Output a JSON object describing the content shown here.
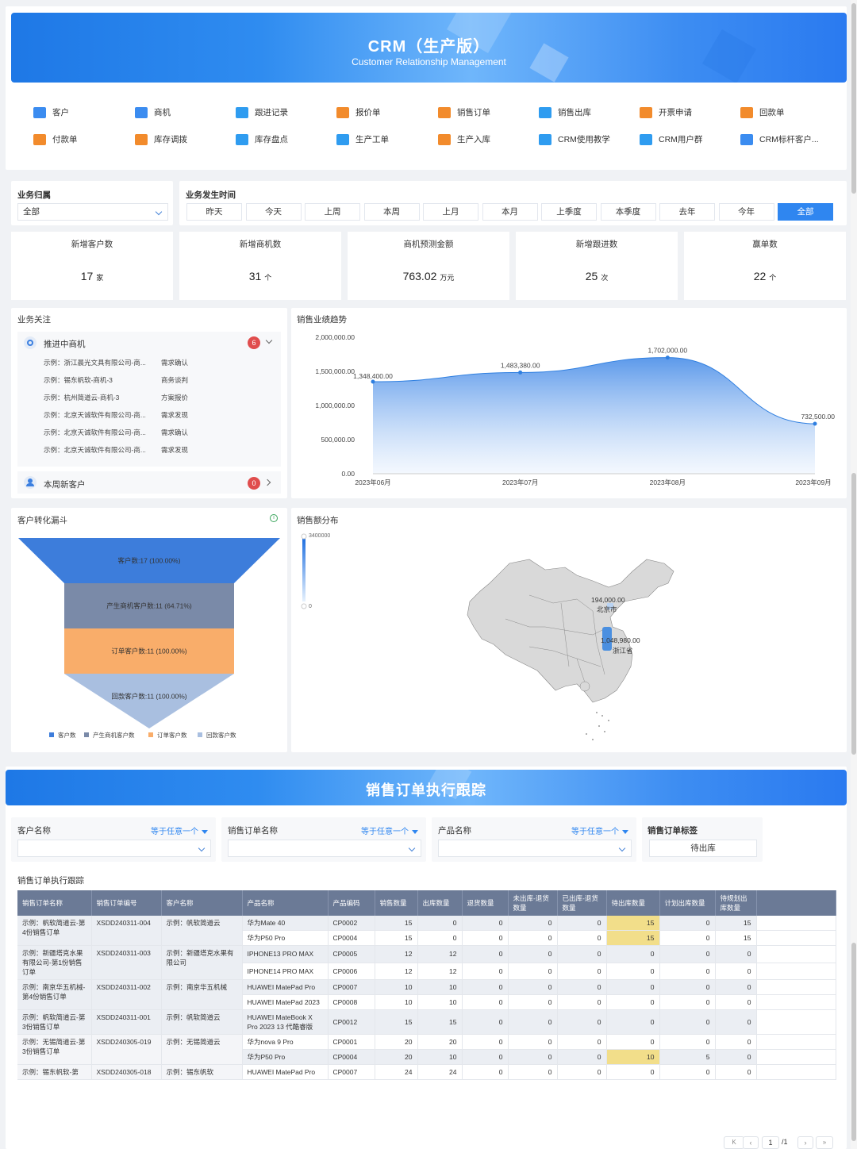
{
  "banner": {
    "title": "CRM（生产版）",
    "subtitle": "Customer Relationship Management"
  },
  "quick_links": [
    {
      "label": "客户",
      "icon": "user-icon",
      "color": "blue"
    },
    {
      "label": "商机",
      "icon": "target-icon",
      "color": "blue"
    },
    {
      "label": "跟进记录",
      "icon": "note-icon",
      "color": "teal"
    },
    {
      "label": "报价单",
      "icon": "send-icon",
      "color": "orange"
    },
    {
      "label": "销售订单",
      "icon": "order-icon",
      "color": "orange"
    },
    {
      "label": "销售出库",
      "icon": "doc-icon",
      "color": "teal"
    },
    {
      "label": "开票申请",
      "icon": "org-icon",
      "color": "orange"
    },
    {
      "label": "回款单",
      "icon": "org-icon",
      "color": "orange"
    },
    {
      "label": "付款单",
      "icon": "org-icon",
      "color": "orange"
    },
    {
      "label": "库存调拨",
      "icon": "org-icon",
      "color": "orange"
    },
    {
      "label": "库存盘点",
      "icon": "doc-icon",
      "color": "teal"
    },
    {
      "label": "生产工单",
      "icon": "doc-icon",
      "color": "teal"
    },
    {
      "label": "生产入库",
      "icon": "doc-icon",
      "color": "orange"
    },
    {
      "label": "CRM使用教学",
      "icon": "stack-icon",
      "color": "teal"
    },
    {
      "label": "CRM用户群",
      "icon": "list-icon",
      "color": "teal"
    },
    {
      "label": "CRM标杆客户...",
      "icon": "users-icon",
      "color": "blue"
    }
  ],
  "filters": {
    "business_owner_label": "业务归属",
    "business_owner_value": "全部",
    "time_label": "业务发生时间",
    "time_buttons": [
      "昨天",
      "今天",
      "上周",
      "本周",
      "上月",
      "本月",
      "上季度",
      "本季度",
      "去年",
      "今年",
      "全部"
    ],
    "active_time": "全部"
  },
  "kpis": [
    {
      "label": "新增客户数",
      "value": "17",
      "unit": "家"
    },
    {
      "label": "新增商机数",
      "value": "31",
      "unit": "个"
    },
    {
      "label": "商机预测金额",
      "value": "763.02",
      "unit": "万元"
    },
    {
      "label": "新增跟进数",
      "value": "25",
      "unit": "次"
    },
    {
      "label": "赢单数",
      "value": "22",
      "unit": "个"
    }
  ],
  "focus": {
    "title": "业务关注",
    "group1": {
      "label": "推进中商机",
      "count": "6"
    },
    "rows": [
      {
        "name": "示例：浙江晨光文具有限公司-商...",
        "stage": "需求确认"
      },
      {
        "name": "示例：锡东帆软-商机-3",
        "stage": "商务谈判"
      },
      {
        "name": "示例：杭州简道云-商机-3",
        "stage": "方案报价"
      },
      {
        "name": "示例：北京天诚软件有限公司-商...",
        "stage": "需求发现"
      },
      {
        "name": "示例：北京天诚软件有限公司-商...",
        "stage": "需求确认"
      },
      {
        "name": "示例：北京天诚软件有限公司-商...",
        "stage": "需求发现"
      }
    ],
    "group2": {
      "label": "本周新客户",
      "count": "0"
    }
  },
  "trend": {
    "title": "销售业绩趋势"
  },
  "chart_data": [
    {
      "type": "area",
      "title": "销售业绩趋势",
      "x": [
        "2023年06月",
        "2023年07月",
        "2023年08月",
        "2023年09月"
      ],
      "values": [
        1348400,
        1483380,
        1702000,
        732500
      ],
      "value_labels": [
        "1,348,400.00",
        "1,483,380.00",
        "1,702,000.00",
        "732,500.00"
      ],
      "y_ticks": [
        "2,000,000.00",
        "1,500,000.00",
        "1,000,000.00",
        "500,000.00",
        "0.00"
      ],
      "ylim": [
        0,
        2000000
      ],
      "color": "#2f7fe0"
    },
    {
      "type": "funnel",
      "title": "客户转化漏斗",
      "categories": [
        "客户数",
        "产生商机客户数",
        "订单客户数",
        "回款客户数"
      ],
      "values": [
        17,
        11,
        11,
        11
      ],
      "labels": [
        "客户数:17 (100.00%)",
        "产生商机客户数:11 (64.71%)",
        "订单客户数:11 (100.00%)",
        "回款客户数:11 (100.00%)"
      ],
      "colors": [
        "#3d7ddb",
        "#7a8aa8",
        "#f9ad6a",
        "#a9bfe0"
      ]
    },
    {
      "type": "map",
      "title": "销售额分布",
      "scale": [
        "3400000",
        "0"
      ],
      "regions": [
        {
          "name": "北京市",
          "value": "194,000.00"
        },
        {
          "name": "浙江省",
          "value": "1,048,980.00"
        }
      ]
    }
  ],
  "funnel": {
    "title": "客户转化漏斗"
  },
  "map": {
    "title": "销售额分布",
    "scale_max": "3400000",
    "scale_min": "0",
    "labels": [
      {
        "value": "194,000.00",
        "name": "北京市"
      },
      {
        "value": "1,048,980.00",
        "name": "浙江省"
      }
    ]
  },
  "section2": {
    "title": "销售订单执行跟踪"
  },
  "filters2": {
    "customer_label": "客户名称",
    "order_label": "销售订单名称",
    "product_label": "产品名称",
    "match_text": "等于任意一个",
    "tag_label": "销售订单标签",
    "tag_value": "待出库"
  },
  "table": {
    "title": "销售订单执行跟踪",
    "headers": [
      "销售订单名称",
      "销售订单编号",
      "客户名称",
      "产品名称",
      "产品编码",
      "销售数量",
      "出库数量",
      "退货数量",
      "未出库-退货数量",
      "已出库-退货数量",
      "待出库数量",
      "计划出库数量",
      "待规划出库数量"
    ],
    "orders": [
      {
        "name": "示例：帆软简道云-第4份销售订单",
        "code": "XSDD240311-004",
        "customer": "示例：帆软简道云",
        "items": [
          [
            "华为Mate 40",
            "CP0002",
            "15",
            "0",
            "0",
            "0",
            "0",
            "15",
            "0",
            "15"
          ],
          [
            "华为P50 Pro",
            "CP0004",
            "15",
            "0",
            "0",
            "0",
            "0",
            "15",
            "0",
            "15"
          ]
        ]
      },
      {
        "name": "示例：新疆塔克水果有限公司-第1份销售订单",
        "code": "XSDD240311-003",
        "customer": "示例：新疆塔克水果有限公司",
        "items": [
          [
            "IPHONE13 PRO MAX",
            "CP0005",
            "12",
            "12",
            "0",
            "0",
            "0",
            "0",
            "0",
            "0"
          ],
          [
            "IPHONE14 PRO MAX",
            "CP0006",
            "12",
            "12",
            "0",
            "0",
            "0",
            "0",
            "0",
            "0"
          ]
        ]
      },
      {
        "name": "示例：南京华五机械-第4份销售订单",
        "code": "XSDD240311-002",
        "customer": "示例：南京华五机械",
        "items": [
          [
            "HUAWEI MatePad Pro",
            "CP0007",
            "10",
            "10",
            "0",
            "0",
            "0",
            "0",
            "0",
            "0"
          ],
          [
            "HUAWEI MatePad 2023",
            "CP0008",
            "10",
            "10",
            "0",
            "0",
            "0",
            "0",
            "0",
            "0"
          ]
        ]
      },
      {
        "name": "示例：帆软简道云-第3份销售订单",
        "code": "XSDD240311-001",
        "customer": "示例：帆软简道云",
        "items": [
          [
            "HUAWEI MateBook X Pro 2023 13 代酷睿版",
            "CP0012",
            "15",
            "15",
            "0",
            "0",
            "0",
            "0",
            "0",
            "0"
          ]
        ]
      },
      {
        "name": "示例：无锡简道云-第3份销售订单",
        "code": "XSDD240305-019",
        "customer": "示例：无锡简道云",
        "items": [
          [
            "华为nova 9 Pro",
            "CP0001",
            "20",
            "20",
            "0",
            "0",
            "0",
            "0",
            "0",
            "0"
          ],
          [
            "华为P50 Pro",
            "CP0004",
            "20",
            "10",
            "0",
            "0",
            "0",
            "10",
            "5",
            "0"
          ]
        ]
      },
      {
        "name": "示例：锡东帆软-第",
        "code": "XSDD240305-018",
        "customer": "示例：锡东帆软",
        "items": [
          [
            "HUAWEI MatePad Pro",
            "CP0007",
            "24",
            "24",
            "0",
            "0",
            "0",
            "0",
            "0",
            "0"
          ]
        ]
      }
    ]
  },
  "pager": {
    "page": "1",
    "total": "/1"
  }
}
